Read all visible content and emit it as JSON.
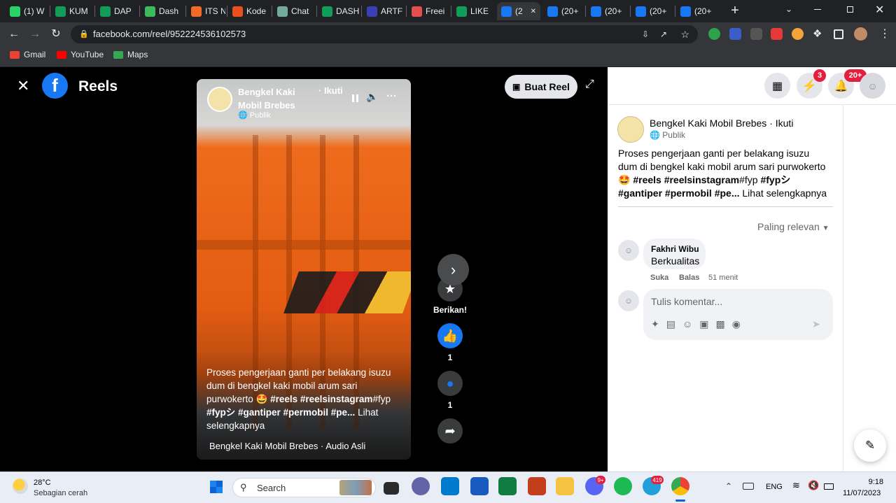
{
  "browser": {
    "tabs": [
      {
        "label": "(1) W",
        "color": "#25d366",
        "icon": "whatsapp-icon"
      },
      {
        "label": "KUM",
        "color": "#0f9d58",
        "icon": "sheets-icon"
      },
      {
        "label": "DAP",
        "color": "#0f9d58",
        "icon": "sheets-icon"
      },
      {
        "label": "Dash",
        "color": "#3dbb5b",
        "icon": "dashboard-icon"
      },
      {
        "label": "ITS N",
        "color": "#f06b25",
        "icon": "its-icon"
      },
      {
        "label": "Kode",
        "color": "#e8511d",
        "icon": "kode-icon"
      },
      {
        "label": "Chat",
        "color": "#74aa9c",
        "icon": "chatgpt-icon"
      },
      {
        "label": "DASH",
        "color": "#0f9d58",
        "icon": "sheets-icon"
      },
      {
        "label": "ARTF",
        "color": "#3b3fb6",
        "icon": "artf-icon"
      },
      {
        "label": "Freei",
        "color": "#e34f4f",
        "icon": "freeimage-icon"
      },
      {
        "label": "LIKE",
        "color": "#0f9d58",
        "icon": "sheets-icon"
      },
      {
        "label": "(2",
        "color": "#1877f2",
        "icon": "facebook-icon"
      },
      {
        "label": "(20+",
        "color": "#1877f2",
        "icon": "facebook-icon"
      },
      {
        "label": "(20+",
        "color": "#1877f2",
        "icon": "facebook-icon"
      },
      {
        "label": "(20+",
        "color": "#1877f2",
        "icon": "facebook-icon"
      },
      {
        "label": "(20+",
        "color": "#1877f2",
        "icon": "facebook-icon"
      }
    ],
    "active_tab_index": 11,
    "new_tab": "+",
    "url": "facebook.com/reel/952224536102573",
    "bookmarks": [
      {
        "label": "Gmail",
        "icon": "gmail-icon",
        "color": "#ea4335"
      },
      {
        "label": "YouTube",
        "icon": "youtube-icon",
        "color": "#ff0000"
      },
      {
        "label": "Maps",
        "icon": "maps-icon",
        "color": "#34a853"
      }
    ]
  },
  "reels": {
    "title": "Reels",
    "create_button": "Buat Reel",
    "video": {
      "author": "Bengkel Kaki Mobil Brebes",
      "follow": "· Ikuti",
      "privacy": "Publik",
      "caption_plain": "Proses pengerjaan ganti per belakang isuzu dum di bengkel kaki mobil arum sari purwokerto 🤩 ",
      "caption_tags": "#reels #reelsinstagram",
      "caption_tail": "#fyp ",
      "caption_tags2": "#fypシ #gantiper #permobil #pe...",
      "see_more": "Lihat selengkapnya",
      "audio": "Bengkel Kaki Mobil Brebes · Audio Asli"
    },
    "actions": {
      "give_label": "Berikan!",
      "like_count": "1",
      "comment_count": "1"
    }
  },
  "post_panel": {
    "messenger_badge": "3",
    "notif_badge": "20+",
    "author_line": "Bengkel Kaki Mobil Brebes · Ikuti",
    "privacy": "Publik",
    "caption_plain": "Proses pengerjaan ganti per belakang isuzu dum di bengkel kaki mobil arum sari purwokerto 🤩 ",
    "caption_tags": "#reels #reelsinstagram",
    "caption_tail": "#fyp ",
    "caption_tags2": "#fypシ #gantiper #permobil #pe...",
    "see_more": "Lihat selengkapnya",
    "sort_label": "Paling relevan",
    "comment": {
      "name": "Fakhri Wibu",
      "text": "Berkualitas",
      "like": "Suka",
      "reply": "Balas",
      "time": "51 menit"
    },
    "comment_placeholder": "Tulis komentar..."
  },
  "taskbar": {
    "weather_temp": "28°C",
    "weather_desc": "Sebagian cerah",
    "search_label": "Search",
    "discord_badge": "9+",
    "telegram_badge": "419",
    "language": "ENG",
    "time": "9:18",
    "date": "11/07/2023"
  },
  "colors": {
    "facebook_blue": "#1877f2",
    "badge_red": "#e41e3f",
    "video_orange": "#ee6b1c"
  }
}
